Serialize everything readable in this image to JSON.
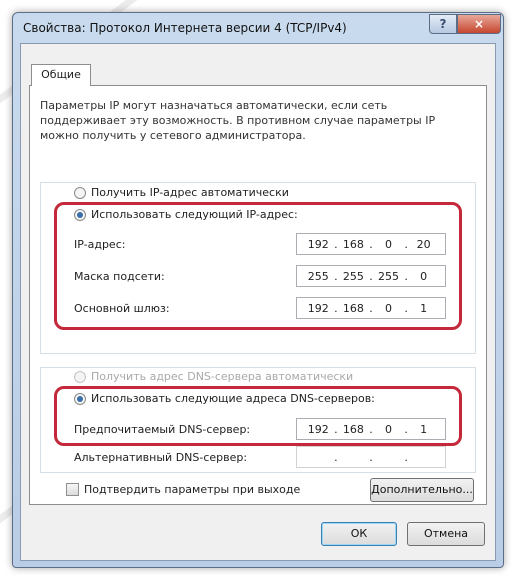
{
  "window": {
    "title": "Свойства: Протокол Интернета версии 4 (TCP/IPv4)",
    "help_glyph": "?",
    "close_glyph": "×"
  },
  "tabs": [
    {
      "label": "Общие",
      "active": true
    }
  ],
  "description": "Параметры IP могут назначаться автоматически, если сеть поддерживает эту возможность. В противном случае параметры IP можно получить у сетевого администратора.",
  "ip": {
    "auto_label": "Получить IP-адрес автоматически",
    "manual_label": "Использовать следующий IP-адрес:",
    "manual_selected": true,
    "fields": [
      {
        "label": "IP-адрес:",
        "octets": [
          "192",
          "168",
          "0",
          "20"
        ]
      },
      {
        "label": "Маска подсети:",
        "octets": [
          "255",
          "255",
          "255",
          "0"
        ]
      },
      {
        "label": "Основной шлюз:",
        "octets": [
          "192",
          "168",
          "0",
          "1"
        ]
      }
    ]
  },
  "dns": {
    "auto_label": "Получить адрес DNS-сервера автоматически",
    "auto_disabled": true,
    "manual_label": "Использовать следующие адреса DNS-серверов:",
    "manual_selected": true,
    "fields": [
      {
        "label": "Предпочитаемый DNS-сервер:",
        "octets": [
          "192",
          "168",
          "0",
          "1"
        ]
      },
      {
        "label": "Альтернативный DNS-сервер:",
        "octets": [
          "",
          "",
          "",
          ""
        ]
      }
    ]
  },
  "validate_on_exit": {
    "label": "Подтвердить параметры при выходе",
    "checked": false
  },
  "buttons": {
    "advanced": "Дополнительно...",
    "ok": "ОК",
    "cancel": "Отмена"
  },
  "colors": {
    "highlight": "#c5283a",
    "title_bar": "#c3d5ec",
    "close_button": "#c5462f"
  }
}
